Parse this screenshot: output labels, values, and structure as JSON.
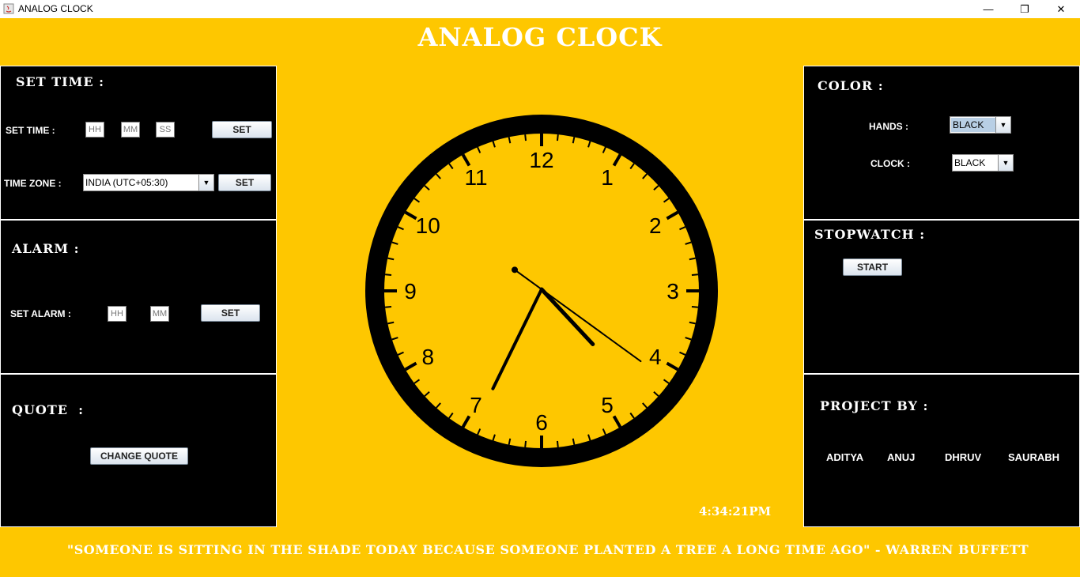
{
  "window": {
    "title": "ANALOG CLOCK",
    "minimize": "—",
    "maximize": "❐",
    "close": "✕"
  },
  "app_title": "ANALOG CLOCK",
  "set_time": {
    "heading": "SET TIME :",
    "set_time_label": "SET TIME :",
    "hh": "HH",
    "mm": "MM",
    "ss": "SS",
    "set_button": "SET",
    "timezone_label": "TIME ZONE :",
    "timezone_value": "INDIA (UTC+05:30)",
    "timezone_set_button": "SET"
  },
  "alarm": {
    "heading": "ALARM :",
    "set_alarm_label": "SET ALARM :",
    "hh": "HH",
    "mm": "MM",
    "set_button": "SET"
  },
  "quote_panel": {
    "heading": "QUOTE  :",
    "change_button": "CHANGE QUOTE"
  },
  "color": {
    "heading": "COLOR :",
    "hands_label": "HANDS :",
    "hands_value": "BLACK",
    "clock_label": "CLOCK :",
    "clock_value": "BLACK"
  },
  "stopwatch": {
    "heading": "STOPWATCH :",
    "start_button": "START"
  },
  "project": {
    "heading": "PROJECT BY :",
    "members": [
      "ADITYA",
      "ANUJ",
      "DHRUV",
      "SAURABH"
    ]
  },
  "clock": {
    "numerals": [
      "12",
      "1",
      "2",
      "3",
      "4",
      "5",
      "6",
      "7",
      "8",
      "9",
      "10",
      "11"
    ],
    "time": {
      "hour": 4,
      "minute": 34,
      "second": 21
    },
    "face_color": "#fec700",
    "ring_color": "#000000"
  },
  "digital_time": "4:34:21PM",
  "quote_text": "\"SOMEONE IS SITTING IN THE SHADE TODAY BECAUSE SOMEONE PLANTED A TREE A LONG TIME AGO\"   -  WARREN BUFFETT",
  "colors": {
    "background": "#fec700",
    "panel": "#000000",
    "text": "#ffffff"
  }
}
